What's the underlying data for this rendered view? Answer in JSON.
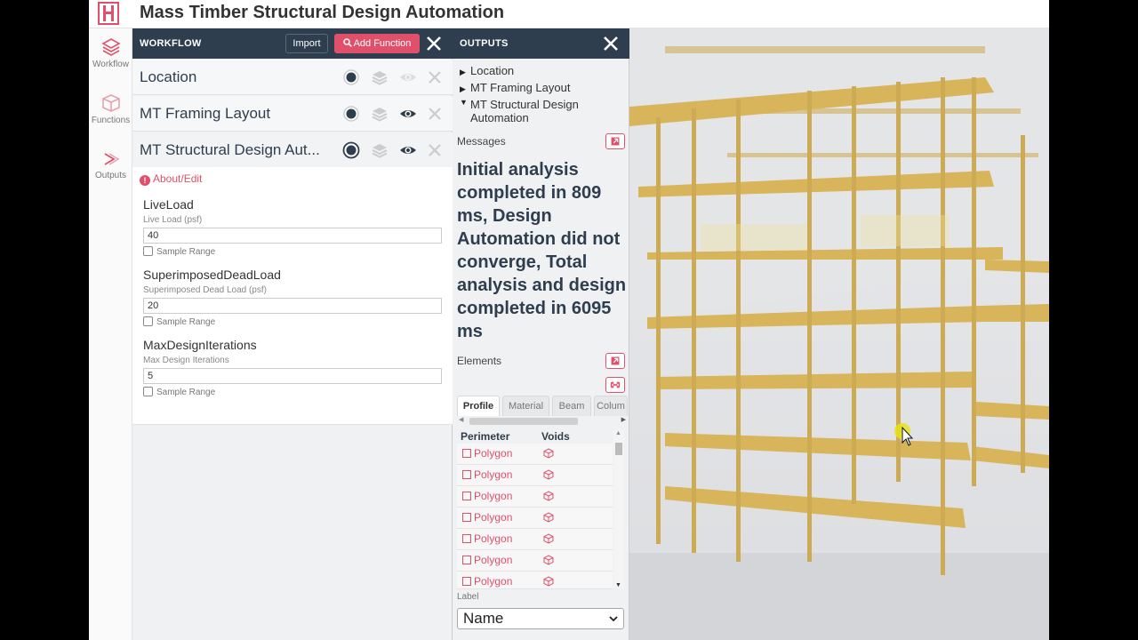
{
  "app": {
    "title": "Mass Timber Structural Design Automation"
  },
  "rail": {
    "workflow": "Workflow",
    "functions": "Functions",
    "outputs": "Outputs"
  },
  "workflow": {
    "title": "WORKFLOW",
    "import_label": "Import",
    "add_label": "Add Function",
    "functions": [
      {
        "label": "Location"
      },
      {
        "label": "MT Framing Layout"
      },
      {
        "label": "MT Structural Design Aut..."
      }
    ],
    "about_label": "About/Edit",
    "fields": [
      {
        "name": "LiveLoad",
        "sub": "Live Load (psf)",
        "value": "40",
        "sample": "Sample Range"
      },
      {
        "name": "SuperimposedDeadLoad",
        "sub": "Superimposed Dead Load (psf)",
        "value": "20",
        "sample": "Sample Range"
      },
      {
        "name": "MaxDesignIterations",
        "sub": "Max Design Iterations",
        "value": "5",
        "sample": "Sample Range"
      }
    ]
  },
  "outputs": {
    "title": "OUTPUTS",
    "tree": [
      "Location",
      "MT Framing Layout",
      "MT Structural Design Automation"
    ],
    "messages_label": "Messages",
    "message": "Initial analysis completed in 809 ms, Design Automation did not converge, Total analysis and design completed in 6095 ms",
    "elements_label": "Elements",
    "tabs": [
      "Profile",
      "Material",
      "Beam",
      "Colum"
    ],
    "columns": [
      "Perimeter",
      "Voids"
    ],
    "rows": [
      "Polygon",
      "Polygon",
      "Polygon",
      "Polygon",
      "Polygon",
      "Polygon",
      "Polygon"
    ],
    "label_caption": "Label",
    "label_select": "Name"
  },
  "colors": {
    "header": "#2e3e4e",
    "accent": "#e0506a",
    "timber": "#d6b25a"
  }
}
